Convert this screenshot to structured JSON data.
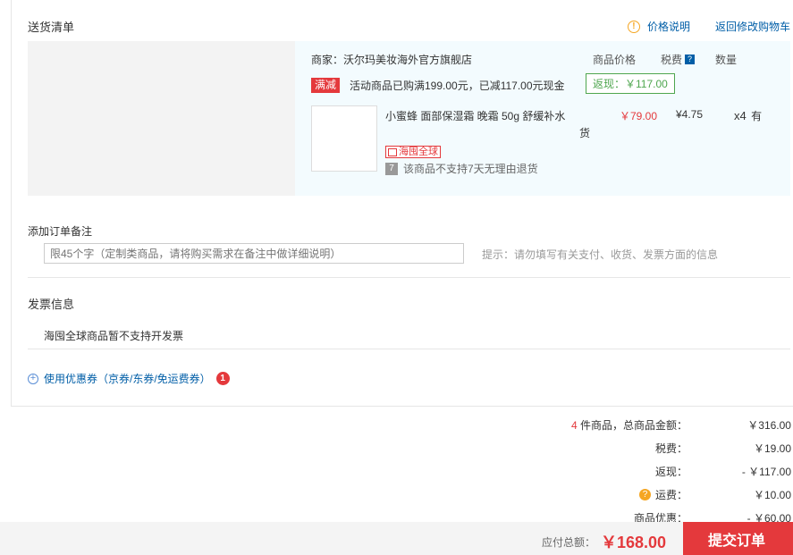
{
  "delivery": {
    "title": "送货清单",
    "price_info_label": "价格说明",
    "back_to_cart_label": "返回修改购物车"
  },
  "goods": {
    "shop": "商家：沃尔玛美妆海外官方旗舰店",
    "col_price": "商品价格",
    "col_tax": "税费",
    "col_qty": "数量",
    "promo_tag": "满减",
    "promo_text": "活动商品已购满199.00元，已减117.00元现金",
    "rebate": "返现：￥117.00",
    "product_name": "小蜜蜂 面部保湿霜 晚霜 50g 舒缓补水",
    "product_name_tail": "货",
    "price": "￥79.00",
    "tax": "¥4.75",
    "qty": "x4",
    "stock": "有",
    "haitao_tag": "海囤全球",
    "no_return": "该商品不支持7天无理由退货",
    "seven_glyph": "7"
  },
  "remark": {
    "title": "添加订单备注",
    "placeholder": "限45个字（定制类商品，请将购买需求在备注中做详细说明）",
    "hint": "提示：请勿填写有关支付、收货、发票方面的信息"
  },
  "invoice": {
    "title": "发票信息",
    "text": "海囤全球商品暂不支持开发票"
  },
  "coupon": {
    "label": "使用优惠券（京券/东券/免运费券）",
    "badge": "1"
  },
  "summary": {
    "count": "4",
    "count_suffix": " 件商品，总商品金额：",
    "total": "￥316.00",
    "tax_label": "税费：",
    "tax": "￥19.00",
    "rebate_label": "返现：",
    "rebate": "- ￥117.00",
    "shipping_label": "运费：",
    "shipping": "￥10.00",
    "discount_label": "商品优惠：",
    "discount": "- ￥60.00"
  },
  "footer": {
    "pay_label": "应付总额：",
    "pay_value": "￥168.00",
    "submit_label": "提交订单"
  },
  "colors": {
    "accent_red": "#e4393c",
    "link_blue": "#005ea7",
    "rebate_green": "#4fa64f",
    "info_orange": "#f5a623"
  }
}
